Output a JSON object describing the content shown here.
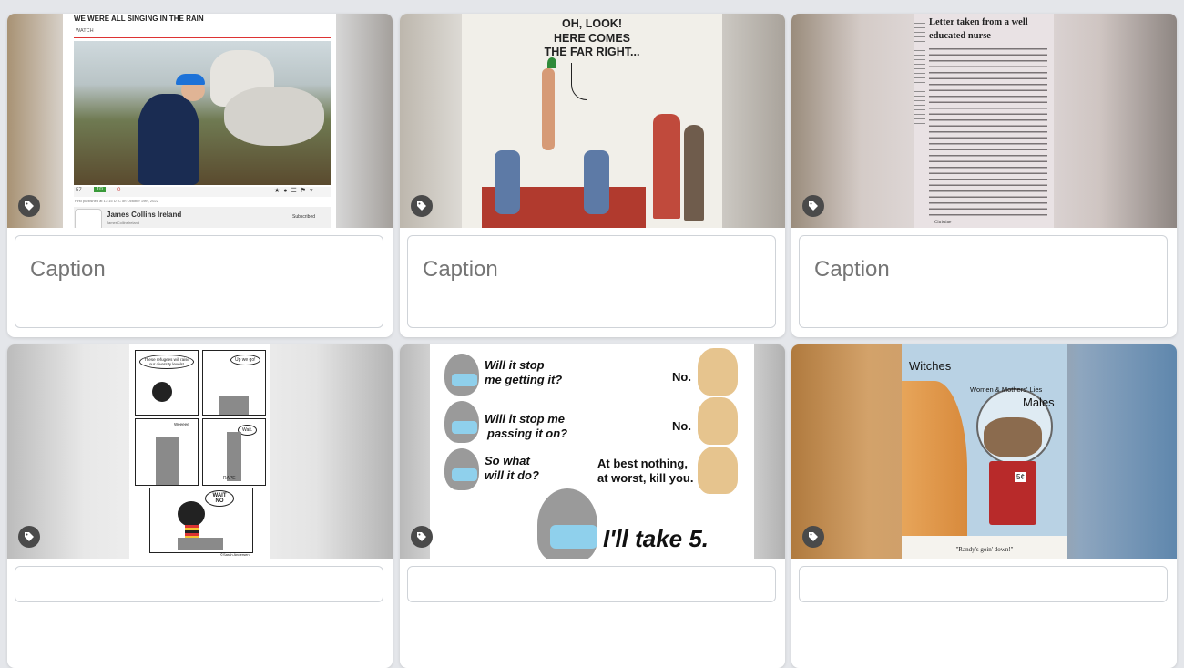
{
  "caption_placeholder": "Caption",
  "tag_icon": "tag-icon",
  "cards": {
    "c1": {
      "video_title": "WE WERE ALL SINGING IN THE RAIN",
      "watch_label": "WATCH",
      "views": "57",
      "likes": "10",
      "dislikes": "0",
      "published": "First published at 17:15 UTC on October 19th, 2022",
      "channel_name": "James Collins Ireland",
      "channel_handle": "JamesCollinsIreland",
      "subscribed_label": "Subscribed"
    },
    "c2": {
      "speech": [
        "OH, LOOK!",
        "HERE COMES",
        "THE FAR RIGHT..."
      ]
    },
    "c3": {
      "headline": [
        "Letter taken from a well",
        "educated nurse"
      ],
      "signature": "Christine"
    },
    "c4": {
      "bubble_1": "These refugees will raise our diversity levels!",
      "bubble_2": "Up we go!",
      "sfx": "Weeeee",
      "bubble_3": "Wait.",
      "bar_label": "RAPE",
      "bubble_4": "WAIT NO",
      "credit": "©Sarah Andersen"
    },
    "c5": {
      "q1": [
        "Will it stop",
        "me getting it?"
      ],
      "a1": "No.",
      "q2": [
        "Will it stop me",
        "passing it on?"
      ],
      "a2": "No.",
      "q3": [
        "So what",
        "will it do?"
      ],
      "a3": [
        "At best nothing,",
        "at worst, kill you."
      ],
      "final": "I'll take 5."
    },
    "c6": {
      "label_witches": "Witches",
      "label_women": "Women & Mothers' Lies",
      "label_males": "Males",
      "price": "5¢",
      "caption": "\"Randy's goin' down!\""
    }
  }
}
